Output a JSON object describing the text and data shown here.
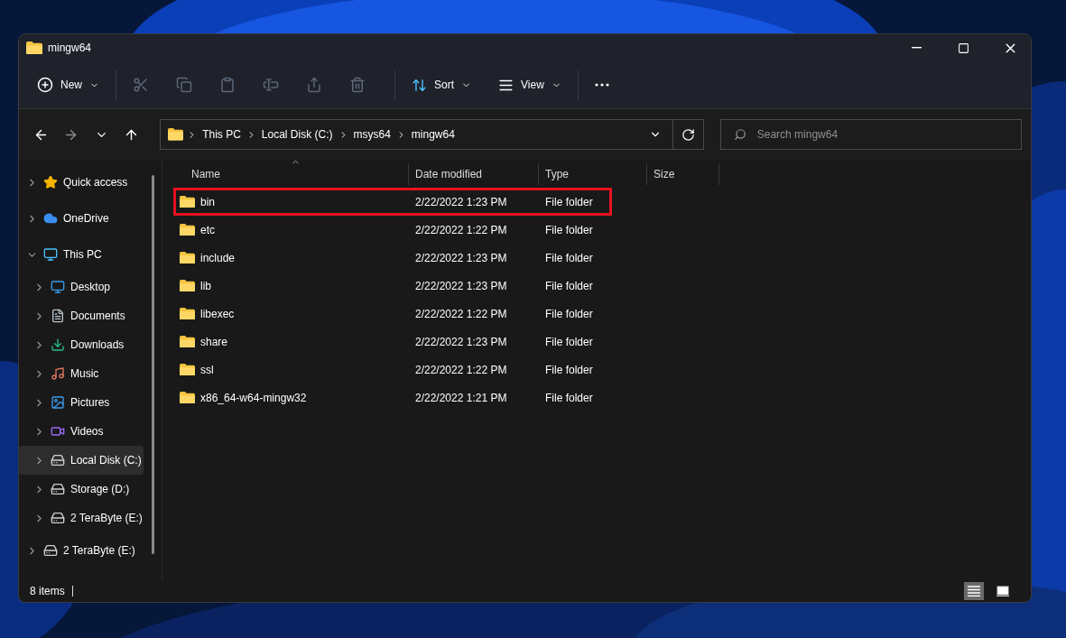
{
  "window": {
    "title": "mingw64"
  },
  "toolbar": {
    "new": {
      "label": "New"
    },
    "actions": [
      {
        "kind": "cut",
        "disabled": true
      },
      {
        "kind": "copy",
        "disabled": true
      },
      {
        "kind": "paste",
        "disabled": true
      },
      {
        "kind": "rename",
        "disabled": true
      },
      {
        "kind": "share",
        "disabled": true
      },
      {
        "kind": "delete",
        "disabled": true
      }
    ],
    "sort": {
      "label": "Sort"
    },
    "view": {
      "label": "View"
    }
  },
  "navigation": {
    "back_disabled": false,
    "forward_disabled": true
  },
  "breadcrumb": [
    "This PC",
    "Local Disk (C:)",
    "msys64",
    "mingw64"
  ],
  "search": {
    "placeholder": "Search mingw64"
  },
  "sidebar": {
    "items": [
      {
        "kind": "star",
        "label": "Quick access",
        "expanded": false,
        "selected": false
      },
      {
        "kind": "cloud",
        "label": "OneDrive",
        "expanded": false,
        "selected": false
      },
      {
        "kind": "pc",
        "label": "This PC",
        "expanded": true,
        "selected": false,
        "children": [
          {
            "kind": "desktop",
            "label": "Desktop",
            "expanded": false,
            "selected": false
          },
          {
            "kind": "documents",
            "label": "Documents",
            "expanded": false,
            "selected": false
          },
          {
            "kind": "downloads",
            "label": "Downloads",
            "expanded": false,
            "selected": false
          },
          {
            "kind": "music",
            "label": "Music",
            "expanded": false,
            "selected": false
          },
          {
            "kind": "pictures",
            "label": "Pictures",
            "expanded": false,
            "selected": false
          },
          {
            "kind": "videos",
            "label": "Videos",
            "expanded": false,
            "selected": false
          },
          {
            "kind": "system_drive",
            "label": "Local Disk (C:)",
            "expanded": false,
            "selected": true
          },
          {
            "kind": "drive",
            "label": "Storage (D:)",
            "expanded": false,
            "selected": false
          },
          {
            "kind": "drive",
            "label": "2 TeraByte (E:)",
            "expanded": false,
            "selected": false
          }
        ]
      },
      {
        "kind": "drive",
        "label": "2 TeraByte (E:)",
        "expanded": false,
        "selected": false
      }
    ]
  },
  "table": {
    "columns": [
      {
        "label": "Name",
        "sorted": true
      },
      {
        "label": "Date modified",
        "sorted": false
      },
      {
        "label": "Type",
        "sorted": false
      },
      {
        "label": "Size",
        "sorted": false
      }
    ],
    "rows": [
      {
        "name": "bin",
        "date": "2/22/2022 1:23 PM",
        "type": "File folder",
        "highlighted": true
      },
      {
        "name": "etc",
        "date": "2/22/2022 1:22 PM",
        "type": "File folder",
        "highlighted": false
      },
      {
        "name": "include",
        "date": "2/22/2022 1:23 PM",
        "type": "File folder",
        "highlighted": false
      },
      {
        "name": "lib",
        "date": "2/22/2022 1:23 PM",
        "type": "File folder",
        "highlighted": false
      },
      {
        "name": "libexec",
        "date": "2/22/2022 1:22 PM",
        "type": "File folder",
        "highlighted": false
      },
      {
        "name": "share",
        "date": "2/22/2022 1:23 PM",
        "type": "File folder",
        "highlighted": false
      },
      {
        "name": "ssl",
        "date": "2/22/2022 1:22 PM",
        "type": "File folder",
        "highlighted": false
      },
      {
        "name": "x86_64-w64-mingw32",
        "date": "2/22/2022 1:21 PM",
        "type": "File folder",
        "highlighted": false
      }
    ]
  },
  "status_bar": {
    "count": "8 items",
    "views": [
      {
        "kind": "details",
        "selected": true
      },
      {
        "kind": "tiles",
        "selected": false
      }
    ]
  }
}
